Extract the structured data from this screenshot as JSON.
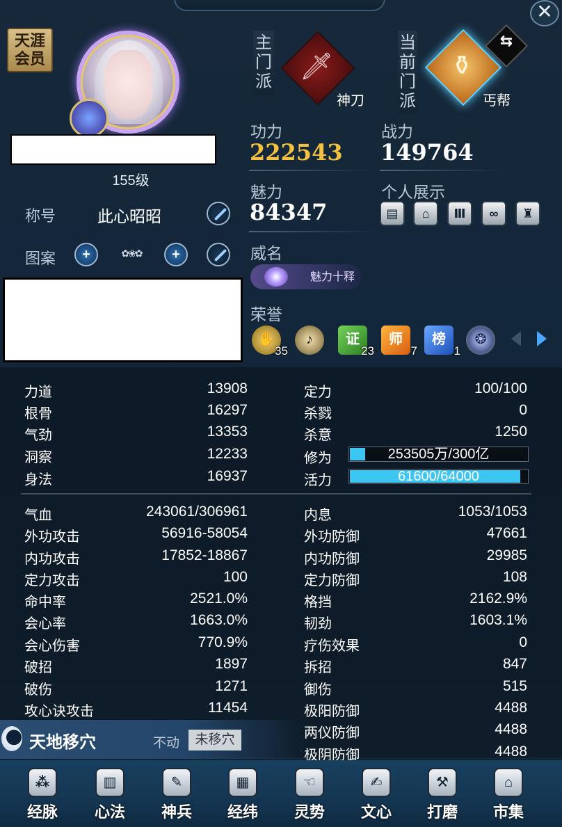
{
  "header": {
    "close_label": "✕"
  },
  "profile": {
    "vip_badge": "天涯\n会员",
    "level": "155级",
    "title_label": "称号",
    "title_value": "此心昭昭",
    "pattern_label": "图案"
  },
  "sects": {
    "main_label": "主门派",
    "main_name": "神刀",
    "current_label": "当前门派",
    "current_name": "丐帮"
  },
  "stats": {
    "kungfu_label": "功力",
    "kungfu_value": "222543",
    "combat_label": "战力",
    "combat_value": "149764",
    "charm_label": "魅力",
    "charm_value": "84347",
    "showcase_label": "个人展示",
    "fame_label": "威名",
    "fame_badge": "魅力十释",
    "honor_label": "荣誉"
  },
  "honors": [
    {
      "icon": "hand-crown-icon",
      "count": "35"
    },
    {
      "icon": "lute-icon",
      "count": ""
    },
    {
      "icon": "证",
      "count": "23"
    },
    {
      "icon": "师",
      "count": "7"
    },
    {
      "icon": "榜",
      "count": "1"
    },
    {
      "icon": "orb-icon",
      "count": ""
    }
  ],
  "attributes": {
    "left_top": [
      {
        "label": "力道",
        "value": "13908"
      },
      {
        "label": "根骨",
        "value": "16297"
      },
      {
        "label": "气劲",
        "value": "13353"
      },
      {
        "label": "洞察",
        "value": "12233"
      },
      {
        "label": "身法",
        "value": "16937"
      }
    ],
    "right_top": [
      {
        "label": "定力",
        "value": "100/100"
      },
      {
        "label": "杀戮",
        "value": "0"
      },
      {
        "label": "杀意",
        "value": "1250"
      }
    ],
    "cultivation": {
      "label": "修为",
      "text": "253505万/300亿",
      "fraction": 0.085
    },
    "vitality": {
      "label": "活力",
      "text": "61600/64000",
      "fraction": 0.9625
    },
    "left_bottom": [
      {
        "label": "气血",
        "value": "243061/306961"
      },
      {
        "label": "外功攻击",
        "value": "56916-58054"
      },
      {
        "label": "内功攻击",
        "value": "17852-18867"
      },
      {
        "label": "定力攻击",
        "value": "100"
      },
      {
        "label": "命中率",
        "value": "2521.0%"
      },
      {
        "label": "会心率",
        "value": "1663.0%"
      },
      {
        "label": "会心伤害",
        "value": "770.9%"
      },
      {
        "label": "破招",
        "value": "1897"
      },
      {
        "label": "破伤",
        "value": "1271"
      },
      {
        "label": "攻心诀攻击",
        "value": "11454"
      }
    ],
    "right_bottom": [
      {
        "label": "内息",
        "value": "1053/1053"
      },
      {
        "label": "外功防御",
        "value": "47661"
      },
      {
        "label": "内功防御",
        "value": "29985"
      },
      {
        "label": "定力防御",
        "value": "108"
      },
      {
        "label": "格挡",
        "value": "2162.9%"
      },
      {
        "label": "韧劲",
        "value": "1603.1%"
      },
      {
        "label": "疗伤效果",
        "value": "0"
      },
      {
        "label": "拆招",
        "value": "847"
      },
      {
        "label": "御伤",
        "value": "515"
      },
      {
        "label": "极阳防御",
        "value": "4488"
      },
      {
        "label": "两仪防御",
        "value": "4488"
      },
      {
        "label": "极阴防御",
        "value": "4488"
      }
    ]
  },
  "acupoint": {
    "title": "天地移穴",
    "status": "不动",
    "button": "未移穴"
  },
  "nav": [
    {
      "label": "经脉",
      "icon": "meridian-icon"
    },
    {
      "label": "心法",
      "icon": "book-icon"
    },
    {
      "label": "神兵",
      "icon": "feather-icon"
    },
    {
      "label": "经纬",
      "icon": "grid-icon"
    },
    {
      "label": "灵势",
      "icon": "hand-icon"
    },
    {
      "label": "文心",
      "icon": "brush-icon"
    },
    {
      "label": "打磨",
      "icon": "hammer-icon"
    },
    {
      "label": "市集",
      "icon": "market-icon"
    }
  ],
  "colors": {
    "accent_gold": "#f5c13e",
    "bar_fill": "#3ec6f2",
    "bg": "#13273a"
  }
}
